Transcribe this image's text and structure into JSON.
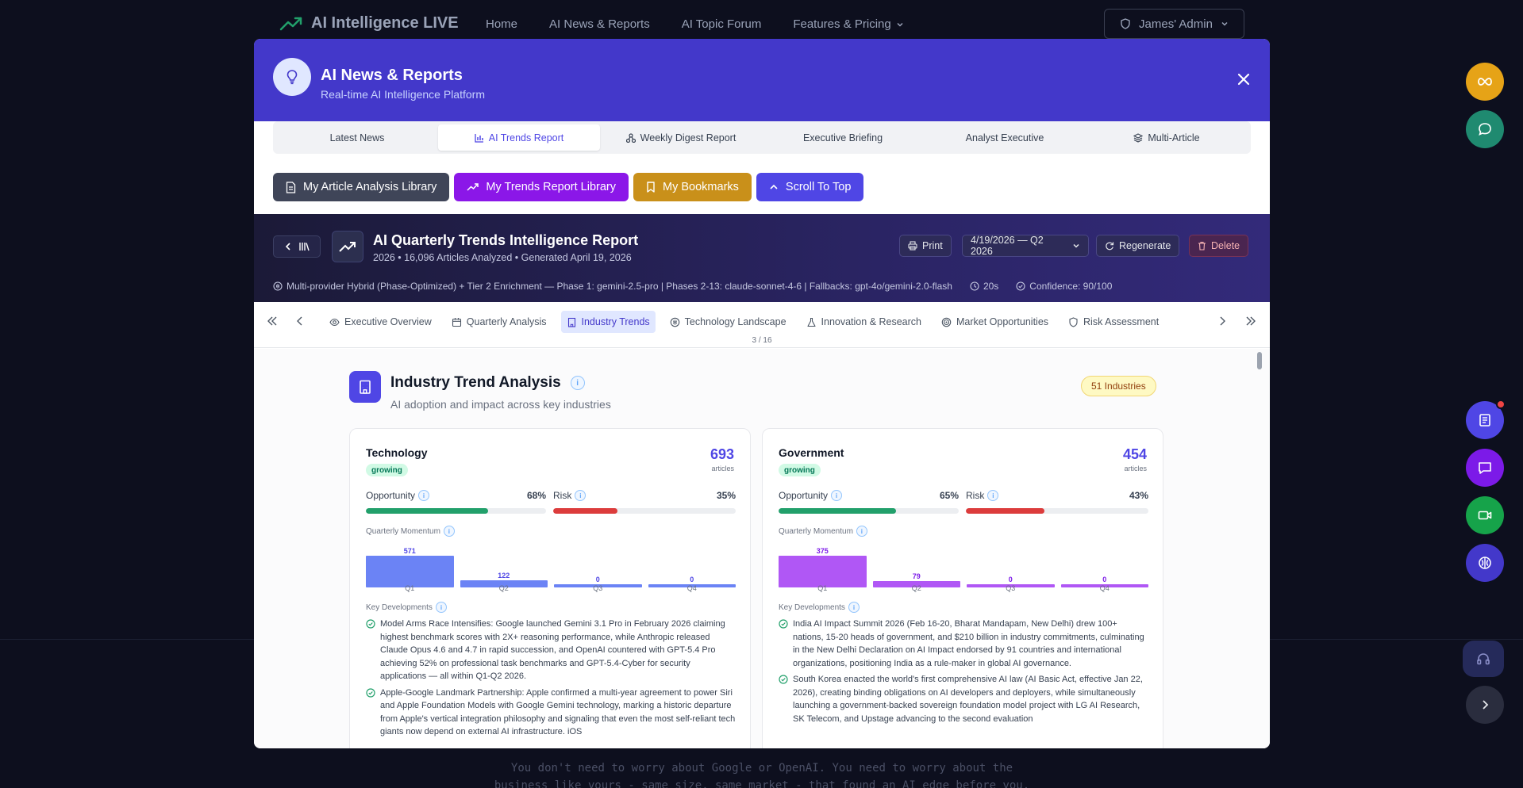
{
  "topnav": {
    "brand": "AI Intelligence LIVE",
    "links": [
      "Home",
      "AI News & Reports",
      "AI Topic Forum",
      "Features & Pricing"
    ],
    "admin_label": "James' Admin"
  },
  "background_text": {
    "line1": "You don't need to worry about Google or OpenAI. You need to worry about the",
    "line2": "business like yours - same size, same market - that found an AI edge before you."
  },
  "colors": {
    "brand_accent": "#4338ca",
    "technology_bar": "#6b83f5",
    "government_bar": "#b057f5",
    "opportunity": "#22a06b",
    "risk": "#dc3c3c"
  },
  "modal": {
    "title": "AI News & Reports",
    "subtitle": "Real-time AI Intelligence Platform",
    "tabs": [
      {
        "label": "Latest News",
        "icon": ""
      },
      {
        "label": "AI Trends Report",
        "icon": "bar-chart-icon",
        "active": true
      },
      {
        "label": "Weekly Digest Report",
        "icon": "network-icon"
      },
      {
        "label": "Executive Briefing",
        "icon": ""
      },
      {
        "label": "Analyst Executive",
        "icon": ""
      },
      {
        "label": "Multi-Article",
        "icon": "layers-icon"
      }
    ],
    "library_buttons": [
      {
        "label": "My Article Analysis Library",
        "icon": "document-icon",
        "color": "#3f4558"
      },
      {
        "label": "My Trends Report Library",
        "icon": "trending-up-icon",
        "color": "#8b17e8"
      },
      {
        "label": "My Bookmarks",
        "icon": "bookmark-icon",
        "color": "#c9901a"
      },
      {
        "label": "Scroll To Top",
        "icon": "chevron-up-icon",
        "color": "#4f46e5"
      }
    ]
  },
  "report": {
    "title": "AI Quarterly Trends Intelligence Report",
    "subtitle": "2026 • 16,096 Articles Analyzed • Generated April 19, 2026",
    "print_label": "Print",
    "period_selected": "4/19/2026 — Q2 2026",
    "regenerate_label": "Regenerate",
    "delete_label": "Delete",
    "meta_providers": "Multi-provider Hybrid (Phase-Optimized) + Tier 2 Enrichment — Phase 1: gemini-2.5-pro | Phases 2-13: claude-sonnet-4-6 | Fallbacks: gpt-4o/gemini-2.0-flash",
    "meta_time": "20s",
    "meta_confidence": "Confidence: 90/100"
  },
  "section_nav": {
    "items": [
      {
        "label": "Executive Overview",
        "icon": "eye-icon"
      },
      {
        "label": "Quarterly Analysis",
        "icon": "calendar-icon"
      },
      {
        "label": "Industry Trends",
        "icon": "building-icon",
        "active": true
      },
      {
        "label": "Technology Landscape",
        "icon": "cpu-icon"
      },
      {
        "label": "Innovation & Research",
        "icon": "flask-icon"
      },
      {
        "label": "Market Opportunities",
        "icon": "target-icon"
      },
      {
        "label": "Risk Assessment",
        "icon": "shield-icon"
      }
    ],
    "page_count": "3 / 16"
  },
  "section": {
    "title": "Industry Trend Analysis",
    "subtitle": "AI adoption and impact across key industries",
    "badge": "51 Industries"
  },
  "cards": [
    {
      "name": "Technology",
      "status": "growing",
      "count": "693",
      "count_unit": "articles",
      "opportunity_label": "Opportunity",
      "opportunity_pct": "68%",
      "opportunity_value": 68,
      "risk_label": "Risk",
      "risk_pct": "35%",
      "risk_value": 35,
      "momentum_label": "Quarterly Momentum",
      "developments_label": "Key Developments",
      "momentum": [
        {
          "q": "Q1",
          "v": 571
        },
        {
          "q": "Q2",
          "v": 122
        },
        {
          "q": "Q3",
          "v": 0
        },
        {
          "q": "Q4",
          "v": 0
        }
      ],
      "developments": [
        "Model Arms Race Intensifies: Google launched Gemini 3.1 Pro in February 2026 claiming highest benchmark scores with 2X+ reasoning performance, while Anthropic released Claude Opus 4.6 and 4.7 in rapid succession, and OpenAI countered with GPT-5.4 Pro achieving 52% on professional task benchmarks and GPT-5.4-Cyber for security applications — all within Q1-Q2 2026.",
        "Apple-Google Landmark Partnership: Apple confirmed a multi-year agreement to power Siri and Apple Foundation Models with Google Gemini technology, marking a historic departure from Apple's vertical integration philosophy and signaling that even the most self-reliant tech giants now depend on external AI infrastructure. iOS"
      ]
    },
    {
      "name": "Government",
      "status": "growing",
      "count": "454",
      "count_unit": "articles",
      "opportunity_label": "Opportunity",
      "opportunity_pct": "65%",
      "opportunity_value": 65,
      "risk_label": "Risk",
      "risk_pct": "43%",
      "risk_value": 43,
      "momentum_label": "Quarterly Momentum",
      "developments_label": "Key Developments",
      "momentum": [
        {
          "q": "Q1",
          "v": 375
        },
        {
          "q": "Q2",
          "v": 79
        },
        {
          "q": "Q3",
          "v": 0
        },
        {
          "q": "Q4",
          "v": 0
        }
      ],
      "developments": [
        "India AI Impact Summit 2026 (Feb 16-20, Bharat Mandapam, New Delhi) drew 100+ nations, 15-20 heads of government, and $210 billion in industry commitments, culminating in the New Delhi Declaration on AI Impact endorsed by 91 countries and international organizations, positioning India as a rule-maker in global AI governance.",
        "South Korea enacted the world's first comprehensive AI law (AI Basic Act, effective Jan 22, 2026), creating binding obligations on AI developers and deployers, while simultaneously launching a government-backed sovereign foundation model project with LG AI Research, SK Telecom, and Upstage advancing to the second evaluation"
      ]
    }
  ]
}
